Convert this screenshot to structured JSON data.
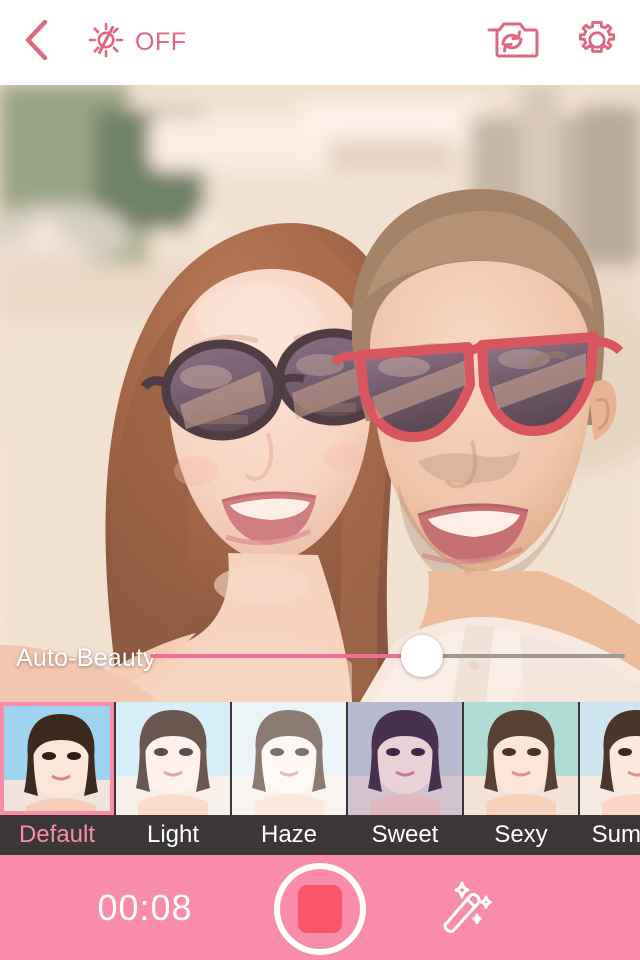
{
  "header": {
    "back_icon": "chevron-left-icon",
    "flash_icon": "flash-off-icon",
    "flash_label": "OFF",
    "flip_icon": "camera-flip-icon",
    "settings_icon": "gear-icon",
    "accent_color": "#dd6880"
  },
  "photo": {
    "description": "Selfie of a smiling couple wearing sunglasses outdoors",
    "alt": "couple-selfie-preview"
  },
  "beauty_slider": {
    "label": "Auto-Beauty",
    "value_percent": 57,
    "track_color": "#9a9a9a",
    "fill_color": "#ef6f95",
    "thumb_color": "#ffffff"
  },
  "filters": {
    "selected": "Default",
    "selected_color": "#f98cab",
    "strip_background": "#3a3736",
    "items": [
      {
        "label": "Default",
        "selected": true
      },
      {
        "label": "Light",
        "selected": false
      },
      {
        "label": "Haze",
        "selected": false
      },
      {
        "label": "Sweet",
        "selected": false
      },
      {
        "label": "Sexy",
        "selected": false
      },
      {
        "label": "Summer",
        "selected": false
      }
    ]
  },
  "bottom_bar": {
    "background_color": "#f98cab",
    "timer": "00:08",
    "record_button": {
      "icon": "stop-recording-icon",
      "state": "recording",
      "inner_color": "#fa5568"
    },
    "magic_icon": "magic-wand-icon"
  }
}
